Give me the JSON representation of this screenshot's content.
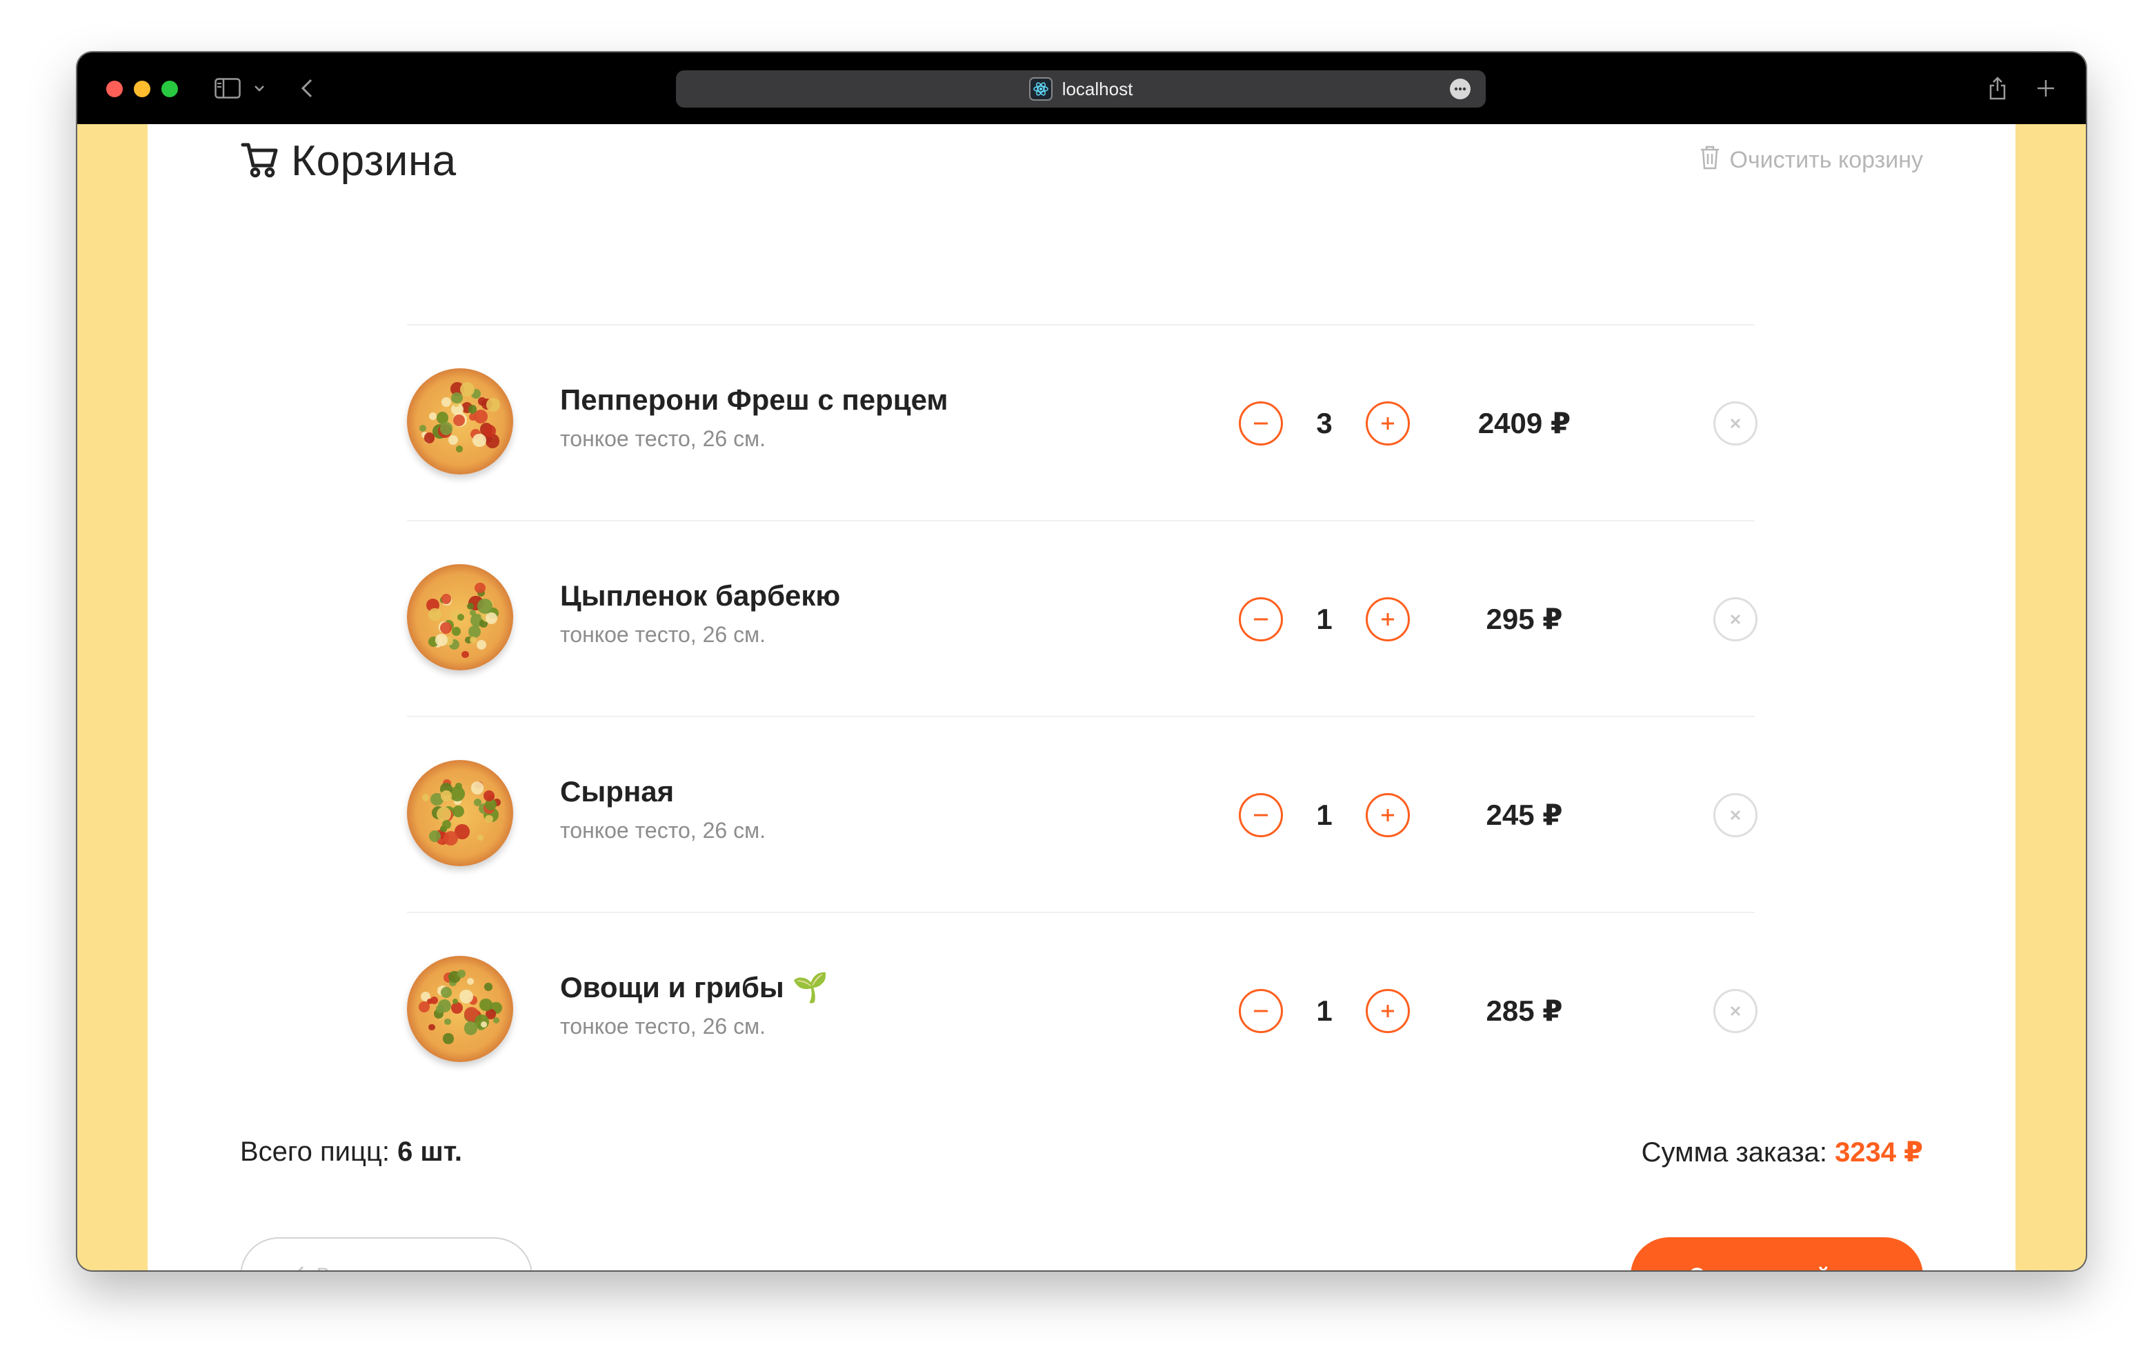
{
  "browser": {
    "url": "localhost",
    "traffic_lights": [
      "close",
      "minimize",
      "zoom"
    ]
  },
  "cart": {
    "title": "Корзина",
    "clear_label": "Очистить корзину",
    "items": [
      {
        "name": "Пепперони Фреш с перцем",
        "subtitle": "тонкое тесто, 26 см.",
        "quantity": "3",
        "price": "2409 ₽",
        "emoji": ""
      },
      {
        "name": "Цыпленок барбекю",
        "subtitle": "тонкое тесто, 26 см.",
        "quantity": "1",
        "price": "295 ₽",
        "emoji": ""
      },
      {
        "name": "Сырная",
        "subtitle": "тонкое тесто, 26 см.",
        "quantity": "1",
        "price": "245 ₽",
        "emoji": ""
      },
      {
        "name": "Овощи и грибы",
        "subtitle": "тонкое тесто, 26 см.",
        "quantity": "1",
        "price": "285 ₽",
        "emoji": "🌱"
      }
    ],
    "total_count_label": "Всего пицц:",
    "total_count_value": "6 шт.",
    "total_sum_label": "Сумма заказа:",
    "total_sum_value": "3234 ₽",
    "back_label": "Вернуться назад",
    "pay_label": "Оплатить сейчас"
  },
  "colors": {
    "accent": "#fe5f1e",
    "page_background": "#fde08c",
    "muted_text": "#8d8d8d"
  },
  "icons": [
    "cart-icon",
    "trash-icon",
    "minus-icon",
    "plus-icon",
    "close-icon",
    "chevron-left-icon",
    "sidebar-icon",
    "share-icon",
    "new-tab-icon"
  ]
}
